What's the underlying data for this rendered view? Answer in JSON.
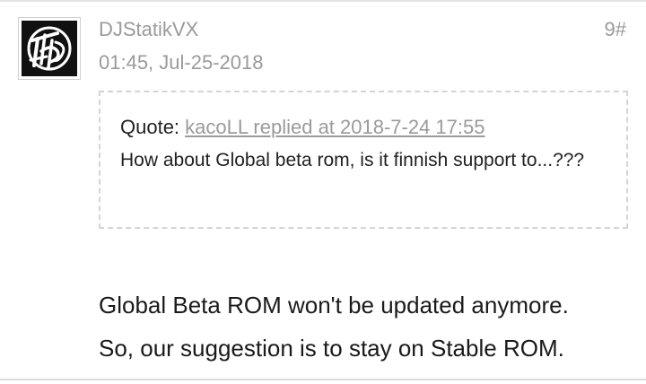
{
  "post": {
    "username": "DJStatikVX",
    "timestamp": "01:45, Jul-25-2018",
    "floor": "9#",
    "quote": {
      "prefix": "Quote:",
      "link_text": "kacoLL replied at 2018-7-24 17:55",
      "text": "How about Global beta rom, is it finnish support to...???"
    },
    "body_lines": [
      "Global Beta ROM won't be updated anymore.",
      "So, our suggestion is to stay on Stable ROM."
    ]
  },
  "colors": {
    "meta_text": "#9a9a9a",
    "body_text": "#1a1a1a",
    "quote_border": "#d4d4d4",
    "avatar_bg": "#111111"
  },
  "icons": {
    "avatar": "user-avatar-logo"
  }
}
